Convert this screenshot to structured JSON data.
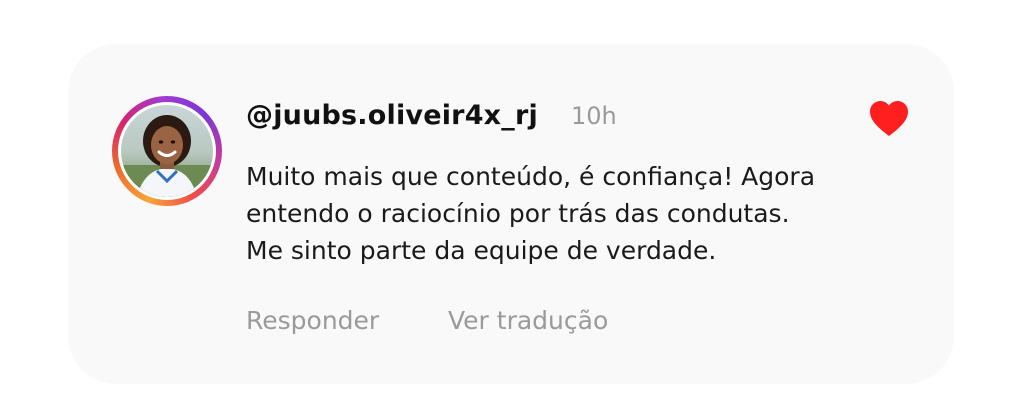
{
  "comment": {
    "username": "@juubs.oliveir4x_rj",
    "time": "10h",
    "text_lines": [
      "Muito mais que conteúdo, é confiança! Agora",
      "entendo o raciocínio por trás das condutas.",
      "Me sinto parte da equipe de verdade."
    ],
    "liked": true,
    "heart_color": "#ff1f1f",
    "actions": {
      "reply_label": "Responder",
      "translate_label": "Ver tradução"
    }
  },
  "avatar": {
    "icon": "user-avatar-photo",
    "ring_colors": [
      "#f7a33b",
      "#ee6a2b",
      "#d6246e",
      "#a23bd1"
    ]
  }
}
